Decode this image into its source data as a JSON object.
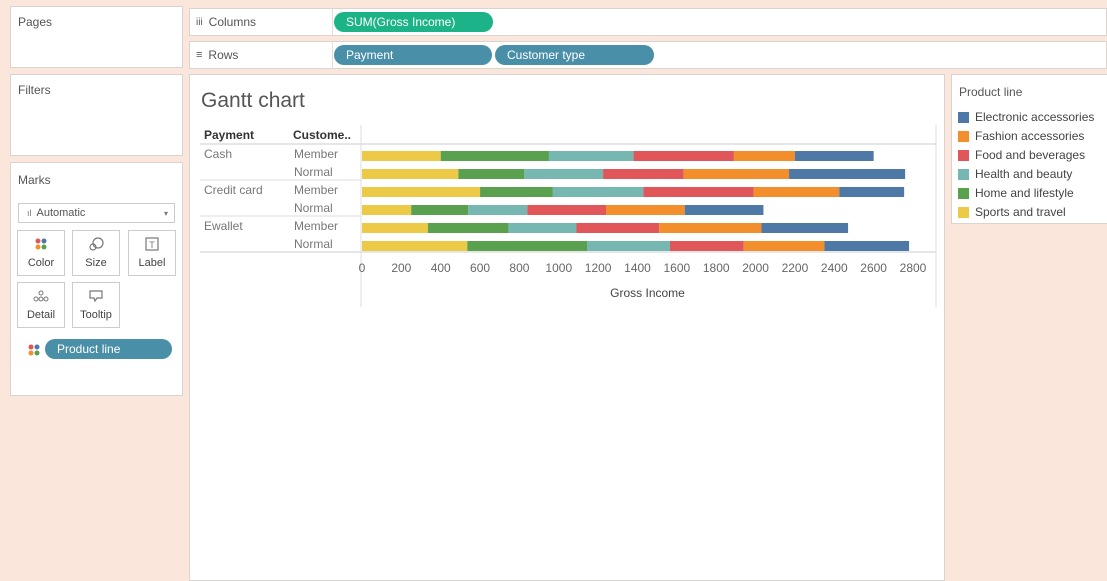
{
  "cards": {
    "pages": "Pages",
    "filters": "Filters",
    "marks": "Marks",
    "mark_type": "Automatic",
    "buttons": [
      "Color",
      "Size",
      "Label",
      "Detail",
      "Tooltip"
    ],
    "color_pill": "Product line"
  },
  "shelves": {
    "columns_label": "Columns",
    "rows_label": "Rows",
    "columns_pills": [
      "SUM(Gross Income)"
    ],
    "rows_pills": [
      "Payment",
      "Customer type"
    ]
  },
  "view": {
    "title": "Gantt chart",
    "header_payment": "Payment",
    "header_customer": "Custome..",
    "payments": [
      "Cash",
      "Credit card",
      "Ewallet"
    ],
    "customer_types": [
      "Member",
      "Normal"
    ]
  },
  "legend": {
    "title": "Product line",
    "items": [
      {
        "label": "Electronic accessories",
        "color": "#4e79a7"
      },
      {
        "label": "Fashion accessories",
        "color": "#f28e2b"
      },
      {
        "label": "Food and beverages",
        "color": "#e15759"
      },
      {
        "label": "Health and beauty",
        "color": "#76b7b2"
      },
      {
        "label": "Home and lifestyle",
        "color": "#59a14f"
      },
      {
        "label": "Sports and travel",
        "color": "#edc948"
      }
    ]
  },
  "chart_data": {
    "type": "bar",
    "stacked": true,
    "orientation": "horizontal",
    "title": "Gantt chart",
    "xlabel": "Gross Income",
    "xlim": [
      0,
      2800
    ],
    "x_ticks": [
      0,
      200,
      400,
      600,
      800,
      1000,
      1200,
      1400,
      1600,
      1800,
      2000,
      2200,
      2400,
      2600,
      2800
    ],
    "categories": [
      "Cash | Member",
      "Cash | Normal",
      "Credit card | Member",
      "Credit card | Normal",
      "Ewallet | Member",
      "Ewallet | Normal"
    ],
    "series": [
      {
        "name": "Sports and travel",
        "color": "#edc948",
        "values": [
          400,
          490,
          600,
          250,
          335,
          535
        ]
      },
      {
        "name": "Home and lifestyle",
        "color": "#59a14f",
        "values": [
          550,
          335,
          370,
          290,
          410,
          610
        ]
      },
      {
        "name": "Health and beauty",
        "color": "#76b7b2",
        "values": [
          430,
          400,
          460,
          300,
          345,
          420
        ]
      },
      {
        "name": "Food and beverages",
        "color": "#e15759",
        "values": [
          510,
          410,
          560,
          400,
          420,
          375
        ]
      },
      {
        "name": "Fashion accessories",
        "color": "#f28e2b",
        "values": [
          310,
          535,
          435,
          400,
          520,
          410
        ]
      },
      {
        "name": "Electronic accessories",
        "color": "#4e79a7",
        "values": [
          400,
          590,
          330,
          400,
          440,
          430
        ]
      }
    ]
  }
}
